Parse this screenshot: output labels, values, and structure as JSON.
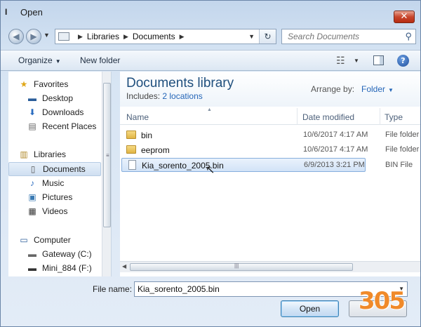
{
  "window": {
    "title": "Open",
    "icon_glyph": "I",
    "close_glyph": "✕"
  },
  "address": {
    "crumbs": [
      "Libraries",
      "Documents"
    ],
    "refresh_glyph": "↻"
  },
  "search": {
    "placeholder": "Search Documents"
  },
  "toolbar": {
    "organize_label": "Organize",
    "new_folder_label": "New folder"
  },
  "nav": {
    "favorites_label": "Favorites",
    "favorites": [
      "Desktop",
      "Downloads",
      "Recent Places"
    ],
    "libraries_label": "Libraries",
    "libraries": [
      "Documents",
      "Music",
      "Pictures",
      "Videos"
    ],
    "computer_label": "Computer",
    "drives": [
      "Gateway (C:)",
      "Mini_884 (F:)"
    ],
    "selected": "Documents"
  },
  "content": {
    "library_title": "Documents library",
    "includes_prefix": "Includes:",
    "includes_link": "2 locations",
    "arrange_label": "Arrange by:",
    "arrange_value": "Folder",
    "columns": {
      "name": "Name",
      "date": "Date modified",
      "type": "Type"
    },
    "files": [
      {
        "name": "bin",
        "date": "10/6/2017 4:17 AM",
        "type": "File folder",
        "kind": "folder"
      },
      {
        "name": "eeprom",
        "date": "10/6/2017 4:17 AM",
        "type": "File folder",
        "kind": "folder"
      },
      {
        "name": "Kia_sorento_2005.bin",
        "date": "6/9/2013 3:21 PM",
        "type": "BIN File",
        "kind": "file"
      }
    ],
    "selected_file": "Kia_sorento_2005.bin"
  },
  "bottom": {
    "file_name_label": "File name:",
    "file_name_value": "Kia_sorento_2005.bin",
    "open_label": "Open"
  },
  "watermark": {
    "text": "305"
  },
  "colors": {
    "accent": "#2566b8",
    "title_blue": "#1f4f7d",
    "close_red": "#c8472e",
    "watermark": "#f08a2a"
  }
}
